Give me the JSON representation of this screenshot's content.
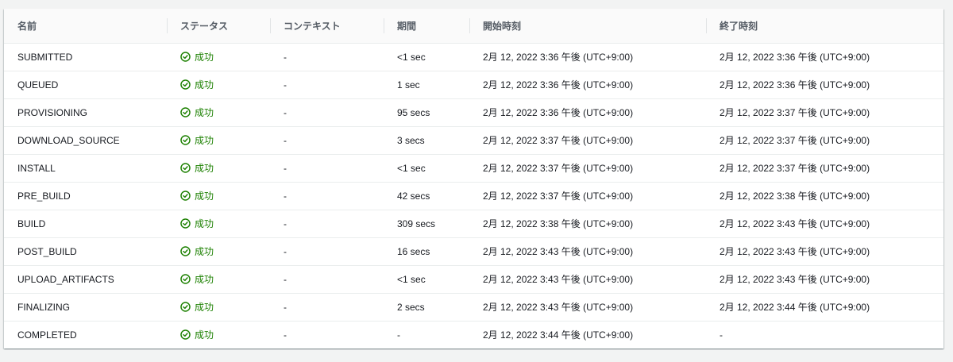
{
  "table": {
    "headers": [
      "名前",
      "ステータス",
      "コンテキスト",
      "期間",
      "開始時刻",
      "終了時刻"
    ],
    "rows": [
      {
        "name": "SUBMITTED",
        "status": "成功",
        "context": "-",
        "duration": "<1 sec",
        "start": "2月 12, 2022 3:36 午後 (UTC+9:00)",
        "end": "2月 12, 2022 3:36 午後 (UTC+9:00)"
      },
      {
        "name": "QUEUED",
        "status": "成功",
        "context": "-",
        "duration": "1 sec",
        "start": "2月 12, 2022 3:36 午後 (UTC+9:00)",
        "end": "2月 12, 2022 3:36 午後 (UTC+9:00)"
      },
      {
        "name": "PROVISIONING",
        "status": "成功",
        "context": "-",
        "duration": "95 secs",
        "start": "2月 12, 2022 3:36 午後 (UTC+9:00)",
        "end": "2月 12, 2022 3:37 午後 (UTC+9:00)"
      },
      {
        "name": "DOWNLOAD_SOURCE",
        "status": "成功",
        "context": "-",
        "duration": "3 secs",
        "start": "2月 12, 2022 3:37 午後 (UTC+9:00)",
        "end": "2月 12, 2022 3:37 午後 (UTC+9:00)"
      },
      {
        "name": "INSTALL",
        "status": "成功",
        "context": "-",
        "duration": "<1 sec",
        "start": "2月 12, 2022 3:37 午後 (UTC+9:00)",
        "end": "2月 12, 2022 3:37 午後 (UTC+9:00)"
      },
      {
        "name": "PRE_BUILD",
        "status": "成功",
        "context": "-",
        "duration": "42 secs",
        "start": "2月 12, 2022 3:37 午後 (UTC+9:00)",
        "end": "2月 12, 2022 3:38 午後 (UTC+9:00)"
      },
      {
        "name": "BUILD",
        "status": "成功",
        "context": "-",
        "duration": "309 secs",
        "start": "2月 12, 2022 3:38 午後 (UTC+9:00)",
        "end": "2月 12, 2022 3:43 午後 (UTC+9:00)"
      },
      {
        "name": "POST_BUILD",
        "status": "成功",
        "context": "-",
        "duration": "16 secs",
        "start": "2月 12, 2022 3:43 午後 (UTC+9:00)",
        "end": "2月 12, 2022 3:43 午後 (UTC+9:00)"
      },
      {
        "name": "UPLOAD_ARTIFACTS",
        "status": "成功",
        "context": "-",
        "duration": "<1 sec",
        "start": "2月 12, 2022 3:43 午後 (UTC+9:00)",
        "end": "2月 12, 2022 3:43 午後 (UTC+9:00)"
      },
      {
        "name": "FINALIZING",
        "status": "成功",
        "context": "-",
        "duration": "2 secs",
        "start": "2月 12, 2022 3:43 午後 (UTC+9:00)",
        "end": "2月 12, 2022 3:44 午後 (UTC+9:00)"
      },
      {
        "name": "COMPLETED",
        "status": "成功",
        "context": "-",
        "duration": "-",
        "start": "2月 12, 2022 3:44 午後 (UTC+9:00)",
        "end": "-"
      }
    ]
  },
  "icons": {
    "status_icon": "check-circle-icon"
  },
  "colors": {
    "success": "#1d8102",
    "header_bg": "#fafafa",
    "page_bg": "#f2f3f3"
  }
}
